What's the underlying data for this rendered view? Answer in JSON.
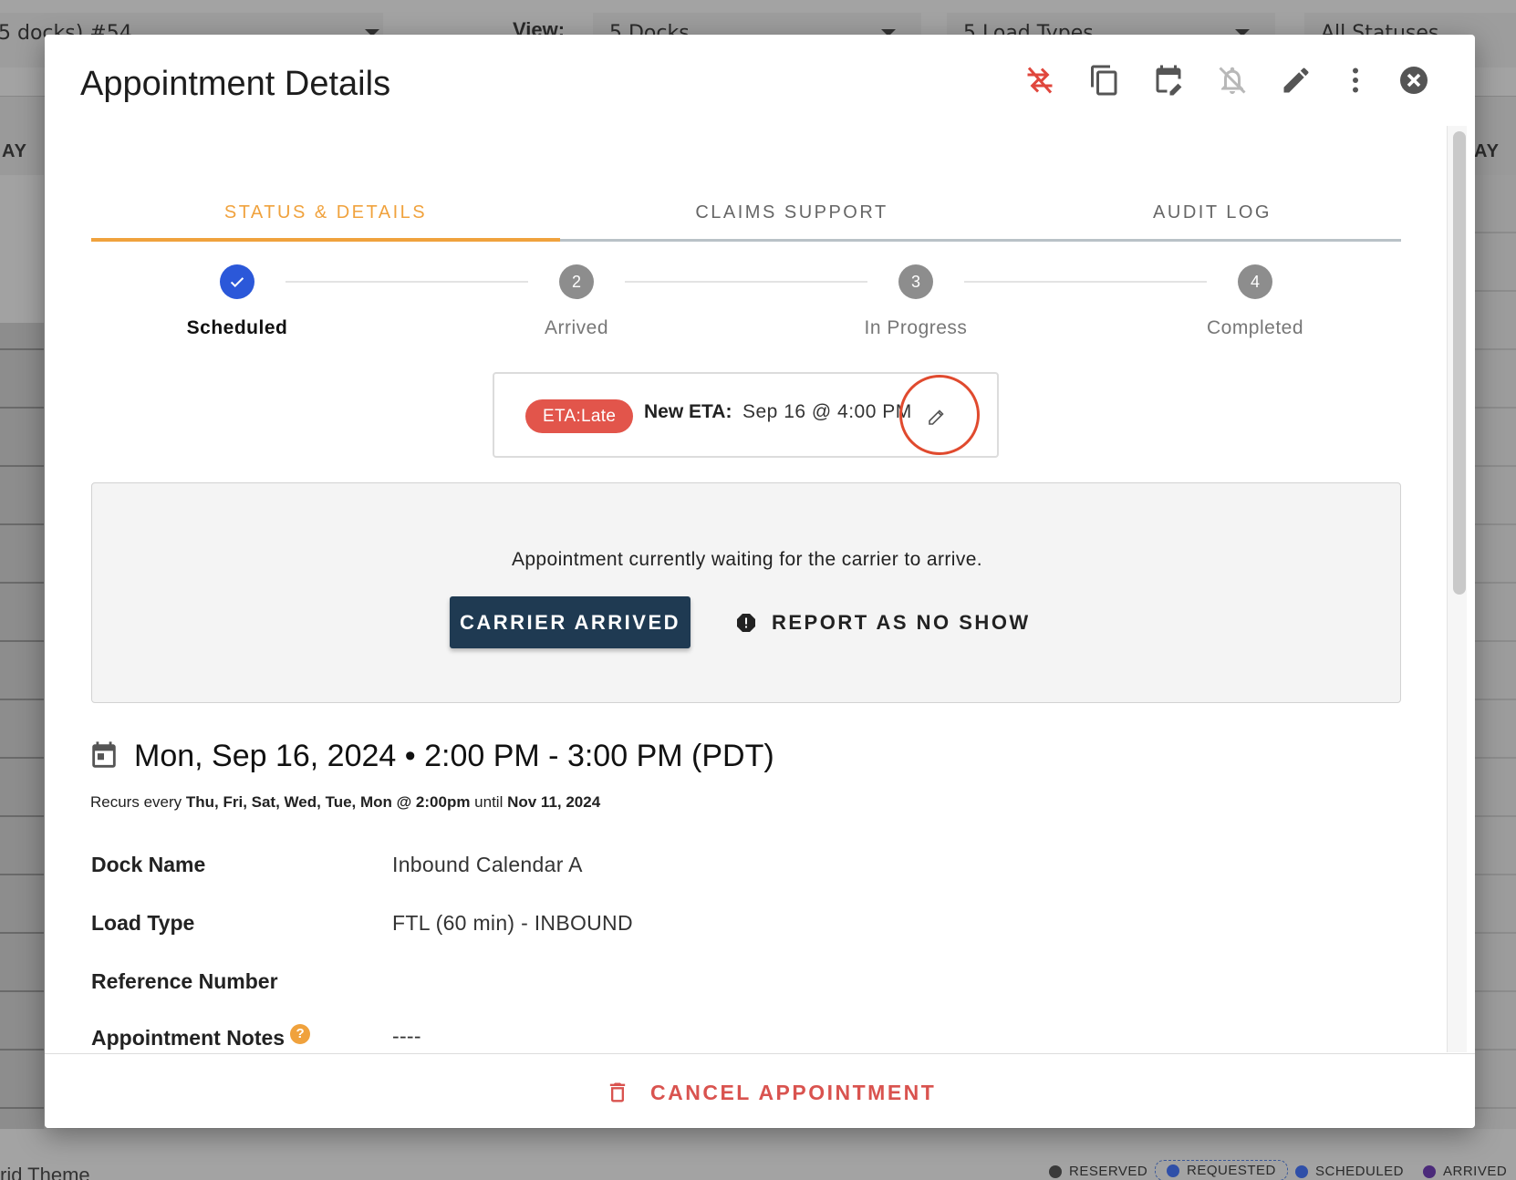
{
  "background": {
    "toolbar": {
      "dock_select_value": "5 docks) #54",
      "view_label": "View:",
      "docks_select_value": "5   Docks",
      "load_types_select_value": "5   Load Types",
      "statuses_select_value": "All Statuses"
    },
    "day_header_left": "AY",
    "day_header_right": "AY",
    "theme_label": "rid Theme",
    "legend": [
      {
        "label": "RESERVED",
        "color": "#3a3a3a"
      },
      {
        "label": "REQUESTED",
        "color": "#2f4fa8"
      },
      {
        "label": "SCHEDULED",
        "color": "#2f4fa8"
      },
      {
        "label": "ARRIVED",
        "color": "#4b2a7a"
      }
    ]
  },
  "modal": {
    "title": "Appointment Details",
    "header_actions": [
      {
        "name": "reschedule-off-icon",
        "color": "#e0473d"
      },
      {
        "name": "copy-icon",
        "color": "#555555"
      },
      {
        "name": "calendar-edit-icon",
        "color": "#555555"
      },
      {
        "name": "bell-off-icon",
        "color": "#b0b0b0"
      },
      {
        "name": "pencil-icon",
        "color": "#555555"
      },
      {
        "name": "more-vertical-icon",
        "color": "#555555"
      },
      {
        "name": "close-icon",
        "color": "#555555"
      }
    ],
    "tabs": [
      {
        "label": "STATUS & DETAILS",
        "active": true
      },
      {
        "label": "CLAIMS SUPPORT",
        "active": false
      },
      {
        "label": "AUDIT LOG",
        "active": false
      }
    ],
    "accent_color": "#f0a23d",
    "steps": [
      {
        "number": "",
        "label": "Scheduled",
        "state": "done"
      },
      {
        "number": "2",
        "label": "Arrived",
        "state": "todo"
      },
      {
        "number": "3",
        "label": "In Progress",
        "state": "todo"
      },
      {
        "number": "4",
        "label": "Completed",
        "state": "todo"
      }
    ],
    "eta": {
      "chip": "ETA:Late",
      "chip_color": "#e2554b",
      "label": "New ETA:",
      "value": "Sep 16 @ 4:00 PM"
    },
    "status_panel": {
      "message": "Appointment currently waiting for the carrier to arrive.",
      "primary_button": "CARRIER ARRIVED",
      "secondary_button": "REPORT AS NO SHOW"
    },
    "date": {
      "text": "Mon, Sep 16, 2024  •  2:00 PM - 3:00 PM (PDT)",
      "recur_prefix": "Recurs every ",
      "recur_days": "Thu, Fri, Sat, Wed, Tue, Mon @ 2:00pm",
      "recur_until_word": " until ",
      "recur_until": "Nov 11, 2024"
    },
    "details": [
      {
        "key": "Dock Name",
        "value": "Inbound Calendar A"
      },
      {
        "key": "Load Type",
        "value": "FTL (60 min) - INBOUND"
      },
      {
        "key": "Reference Number",
        "value": ""
      },
      {
        "key": "Appointment Notes",
        "value": "----",
        "help": "?"
      }
    ],
    "footer": {
      "cancel_button": "CANCEL APPOINTMENT"
    }
  }
}
